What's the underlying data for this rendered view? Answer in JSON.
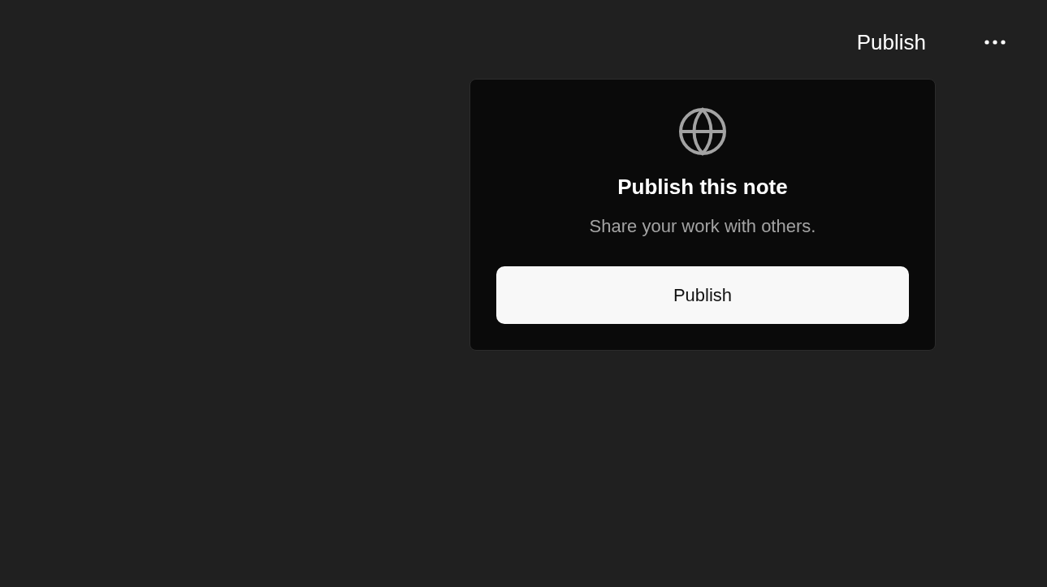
{
  "header": {
    "publish_label": "Publish"
  },
  "popover": {
    "title": "Publish this note",
    "description": "Share your work with others.",
    "button": "Publish"
  }
}
